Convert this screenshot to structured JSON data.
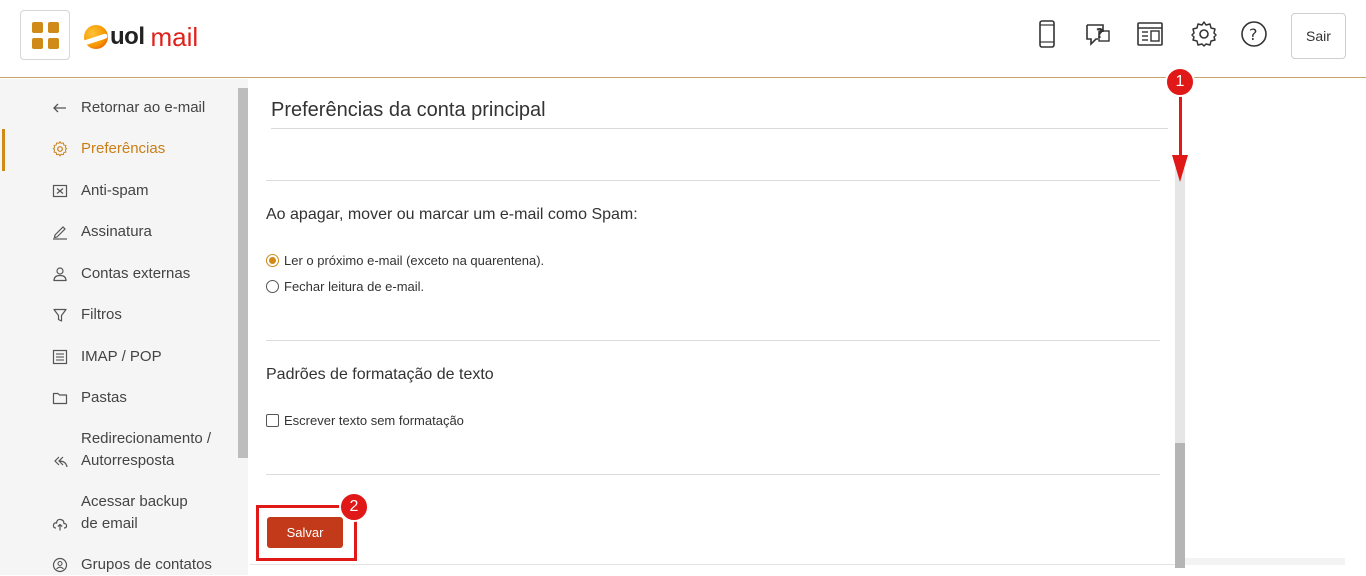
{
  "header": {
    "logo_brand": "uol",
    "logo_product": "mail",
    "logout_label": "Sair",
    "icons": [
      "mobile-icon",
      "help-chat-icon",
      "newsletter-icon",
      "settings-gear-icon",
      "help-question-icon"
    ]
  },
  "sidebar": {
    "items": [
      {
        "label": "Retornar ao e-mail",
        "icon": "arrow-left-icon"
      },
      {
        "label": "Preferências",
        "icon": "gear-icon",
        "active": true
      },
      {
        "label": "Anti-spam",
        "icon": "spam-box-icon"
      },
      {
        "label": "Assinatura",
        "icon": "pen-icon"
      },
      {
        "label": "Contas externas",
        "icon": "user-icon"
      },
      {
        "label": "Filtros",
        "icon": "filter-icon"
      },
      {
        "label": "IMAP / POP",
        "icon": "server-icon"
      },
      {
        "label": "Pastas",
        "icon": "folder-icon"
      },
      {
        "label": "Redirecionamento / Autorresposta",
        "icon": "reply-all-icon"
      },
      {
        "label": "Acessar backup de email",
        "icon": "cloud-upload-icon"
      },
      {
        "label": "Grupos de contatos",
        "icon": "group-icon"
      }
    ]
  },
  "main": {
    "title": "Preferências da conta principal",
    "spam_section": {
      "title": "Ao apagar, mover ou marcar um e-mail como Spam:",
      "options": [
        {
          "label": "Ler o próximo e-mail (exceto na quarentena).",
          "checked": true
        },
        {
          "label": "Fechar leitura de e-mail.",
          "checked": false
        }
      ]
    },
    "format_section": {
      "title": "Padrões de formatação de texto",
      "checkbox_label": "Escrever texto sem formatação",
      "checkbox_checked": false
    },
    "save_label": "Salvar"
  },
  "annotations": {
    "step1": "1",
    "step2": "2"
  },
  "colors": {
    "accent": "#d08a17",
    "save_button": "#c23a1a",
    "annotation": "#e01818",
    "logo_red": "#e0211b"
  }
}
